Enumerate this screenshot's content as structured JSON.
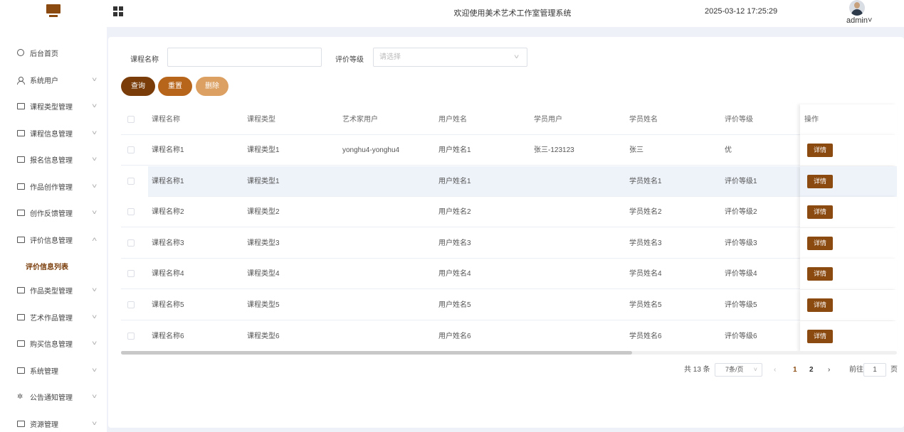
{
  "header": {
    "title": "欢迎使用美术艺术工作室管理系统",
    "datetime": "2025-03-12 17:25:29",
    "user": "admin",
    "user_caret": "˅"
  },
  "sidebar": {
    "items": [
      {
        "label": "后台首页",
        "icon": "clock-icon",
        "arrow": ""
      },
      {
        "label": "系统用户",
        "icon": "user-icon",
        "arrow": "˅"
      },
      {
        "label": "课程类型管理",
        "icon": "card-icon",
        "arrow": "˅"
      },
      {
        "label": "课程信息管理",
        "icon": "card-icon",
        "arrow": "˅"
      },
      {
        "label": "报名信息管理",
        "icon": "card-icon",
        "arrow": "˅"
      },
      {
        "label": "作品创作管理",
        "icon": "card-icon",
        "arrow": "˅"
      },
      {
        "label": "创作反馈管理",
        "icon": "card-icon",
        "arrow": "˅"
      },
      {
        "label": "评价信息管理",
        "icon": "card-icon",
        "arrow": "˄"
      },
      {
        "label": "作品类型管理",
        "icon": "card-icon",
        "arrow": "˅"
      },
      {
        "label": "艺术作品管理",
        "icon": "card-icon",
        "arrow": "˅"
      },
      {
        "label": "购买信息管理",
        "icon": "card-icon",
        "arrow": "˅"
      },
      {
        "label": "系统管理",
        "icon": "inbox-icon",
        "arrow": "˅"
      },
      {
        "label": "公告通知管理",
        "icon": "loading-icon",
        "arrow": "˅"
      },
      {
        "label": "资源管理",
        "icon": "monitor-icon",
        "arrow": "˅"
      }
    ],
    "active_sub": "评价信息列表"
  },
  "search": {
    "course_label": "课程名称",
    "course_value": "",
    "rating_label": "评价等级",
    "rating_placeholder": "请选择"
  },
  "buttons": {
    "query": "查询",
    "reset": "重置",
    "delete": "删除"
  },
  "colors": {
    "query": "#7a3d0a",
    "reset": "#b8651c",
    "delete": "#dba062",
    "detail": "#8b4a0f"
  },
  "table": {
    "columns": [
      "课程名称",
      "课程类型",
      "艺术家用户",
      "用户姓名",
      "学员用户",
      "学员姓名",
      "评价等级",
      "操作"
    ],
    "detail_label": "详情",
    "rows": [
      [
        "课程名称1",
        "课程类型1",
        "yonghu4-yonghu4",
        "用户姓名1",
        "张三-123123",
        "张三",
        "优"
      ],
      [
        "课程名称1",
        "课程类型1",
        "",
        "用户姓名1",
        "",
        "学员姓名1",
        "评价等级1"
      ],
      [
        "课程名称2",
        "课程类型2",
        "",
        "用户姓名2",
        "",
        "学员姓名2",
        "评价等级2"
      ],
      [
        "课程名称3",
        "课程类型3",
        "",
        "用户姓名3",
        "",
        "学员姓名3",
        "评价等级3"
      ],
      [
        "课程名称4",
        "课程类型4",
        "",
        "用户姓名4",
        "",
        "学员姓名4",
        "评价等级4"
      ],
      [
        "课程名称5",
        "课程类型5",
        "",
        "用户姓名5",
        "",
        "学员姓名5",
        "评价等级5"
      ],
      [
        "课程名称6",
        "课程类型6",
        "",
        "用户姓名6",
        "",
        "学员姓名6",
        "评价等级6"
      ]
    ]
  },
  "pagination": {
    "total": "共 13 条",
    "page_size": "7条/页",
    "prev": "‹",
    "pages": [
      "1",
      "2"
    ],
    "current": "1",
    "next": "›",
    "goto_label": "前往",
    "goto_value": "1",
    "goto_suffix": "页"
  }
}
